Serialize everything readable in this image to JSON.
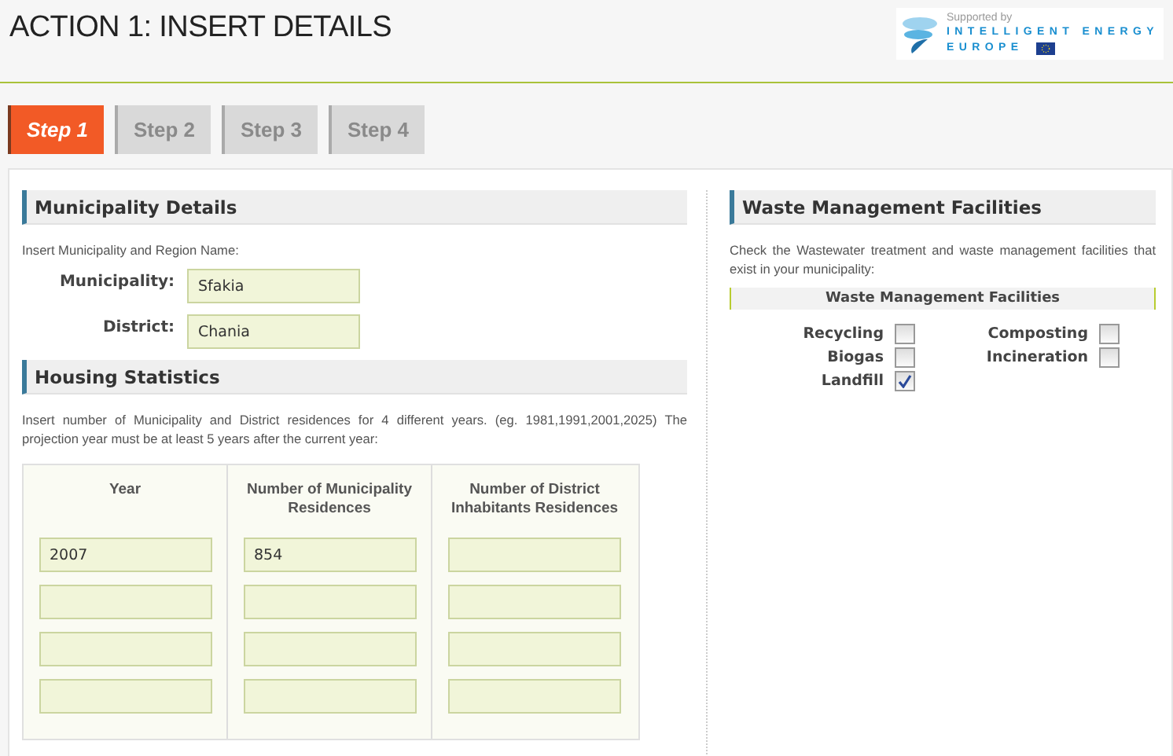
{
  "header": {
    "title": "ACTION 1: INSERT DETAILS",
    "logo": {
      "caption": "Supported by",
      "line_1": "INTELLIGENT ENERGY",
      "line_2": "EUROPE"
    }
  },
  "tabs": [
    {
      "label": "Step 1",
      "selected": true
    },
    {
      "label": "Step 2",
      "selected": false
    },
    {
      "label": "Step 3",
      "selected": false
    },
    {
      "label": "Step 4",
      "selected": false
    }
  ],
  "municipality_details": {
    "heading": "Municipality Details",
    "intro": "Insert Municipality and Region Name:",
    "fields": [
      {
        "label": "Municipality:",
        "value": "Sfakia"
      },
      {
        "label": "District:",
        "value": "Chania"
      }
    ]
  },
  "housing_statistics": {
    "heading": "Housing Statistics",
    "intro": "Insert number of Municipality and District residences for 4 different years. (eg. 1981,1991,2001,2025) The projection year must be at least 5 years after the current year:",
    "columns": [
      {
        "heading": "Year",
        "cells": [
          {
            "value": "2007"
          },
          {},
          {},
          {}
        ]
      },
      {
        "heading": "Number of Municipality Residences",
        "cells": [
          {
            "value": "854"
          },
          {},
          {},
          {}
        ]
      },
      {
        "heading": "Number of District Inhabitants Residences",
        "cells": [
          {},
          {},
          {},
          {}
        ]
      }
    ]
  },
  "waste_management": {
    "heading": "Waste Management Facilities",
    "intro": "Check the Wastewater treatment and waste management facilities that exist in your municipality:",
    "subheading": "Waste Management Facilities",
    "facilities": [
      {
        "label": "Recycling",
        "checked": false
      },
      {
        "label": "Composting",
        "checked": false
      },
      {
        "label": "Biogas",
        "checked": false
      },
      {
        "label": "Incineration",
        "checked": false
      },
      {
        "label": "Landfill",
        "checked": true
      }
    ]
  }
}
